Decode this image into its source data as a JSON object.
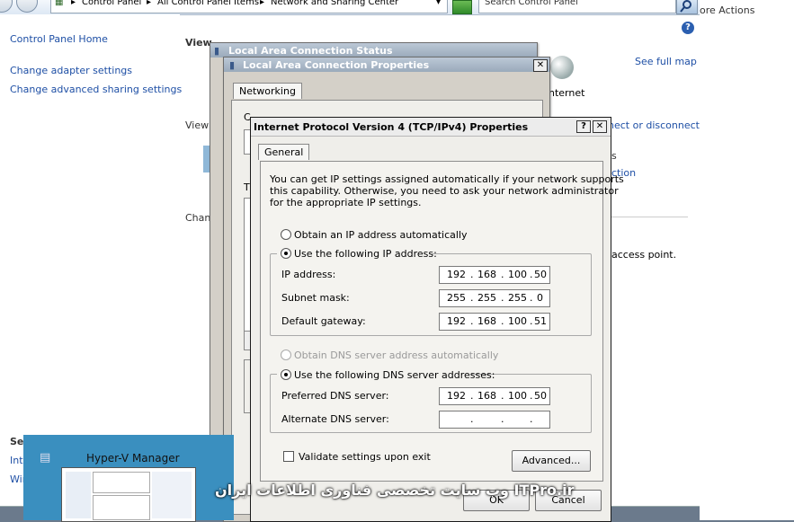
{
  "explorer": {
    "crumbs": [
      "Control Panel",
      "All Control Panel Items",
      "Network and Sharing Center"
    ],
    "search_placeholder": "Search Control Panel",
    "more_actions": "ore Actions"
  },
  "sidebar": {
    "home": "Control Panel Home",
    "links": [
      "Change adapter settings",
      "Change advanced sharing settings"
    ],
    "see_also_header": "Se",
    "bottom_links": [
      "Int",
      "Win"
    ]
  },
  "main": {
    "view_header": "View",
    "view_label": "View",
    "change_label": "Chan",
    "see_full_map": "See full map",
    "internet": "nternet",
    "connect_disconnect": "nect or disconnect",
    "s_frag": "s",
    "ction_frag": "ction",
    "access_point": "access point."
  },
  "status_window": {
    "title": "Local Area Connection Status"
  },
  "properties_window": {
    "title": "Local Area Connection Properties",
    "tab": "Networking",
    "c_label": "C",
    "t_label": "T"
  },
  "tcp_dialog": {
    "title": "Internet Protocol Version 4 (TCP/IPv4) Properties",
    "help": "?",
    "close": "✕",
    "tab": "General",
    "intro": [
      "You can get IP settings assigned automatically if your network supports",
      "this capability. Otherwise, you need to ask your network administrator",
      "for the appropriate IP settings."
    ],
    "auto_ip": "Obtain an IP address automatically",
    "use_ip": "Use the following IP address:",
    "ip_label": "IP address:",
    "ip": [
      "192",
      "168",
      "100",
      "50"
    ],
    "mask_label": "Subnet mask:",
    "mask": [
      "255",
      "255",
      "255",
      "0"
    ],
    "gw_label": "Default gateway:",
    "gw": [
      "192",
      "168",
      "100",
      "51"
    ],
    "auto_dns": "Obtain DNS server address automatically",
    "use_dns": "Use the following DNS server addresses:",
    "pref_label": "Preferred DNS server:",
    "pref": [
      "192",
      "168",
      "100",
      "50"
    ],
    "alt_label": "Alternate DNS server:",
    "alt": [
      "",
      "",
      "",
      ""
    ],
    "validate": "Validate settings upon exit",
    "advanced": "Advanced...",
    "ok": "OK",
    "cancel": "Cancel"
  },
  "hyperv": {
    "title": "Hyper-V Manager"
  },
  "watermark": "وب سایت تخصصی فناوری اطلاعات ایران ITPro.ir"
}
